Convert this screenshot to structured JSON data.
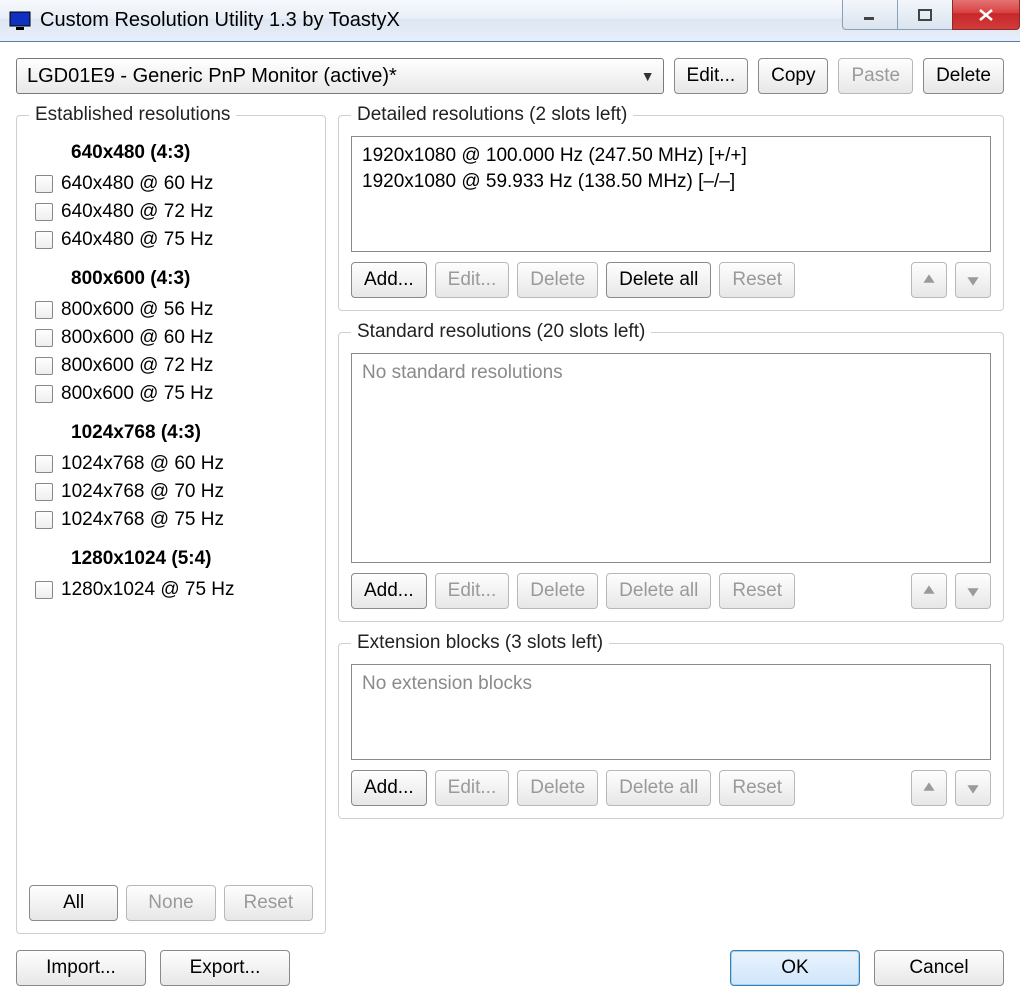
{
  "window": {
    "title": "Custom Resolution Utility 1.3 by ToastyX"
  },
  "top": {
    "monitor_selected": "LGD01E9 - Generic PnP Monitor (active)*",
    "edit": "Edit...",
    "copy": "Copy",
    "paste": "Paste",
    "delete": "Delete"
  },
  "established": {
    "legend": "Established resolutions",
    "groups": [
      {
        "head": "640x480 (4:3)",
        "items": [
          "640x480 @ 60 Hz",
          "640x480 @ 72 Hz",
          "640x480 @ 75 Hz"
        ]
      },
      {
        "head": "800x600 (4:3)",
        "items": [
          "800x600 @ 56 Hz",
          "800x600 @ 60 Hz",
          "800x600 @ 72 Hz",
          "800x600 @ 75 Hz"
        ]
      },
      {
        "head": "1024x768 (4:3)",
        "items": [
          "1024x768 @ 60 Hz",
          "1024x768 @ 70 Hz",
          "1024x768 @ 75 Hz"
        ]
      },
      {
        "head": "1280x1024 (5:4)",
        "items": [
          "1280x1024 @ 75 Hz"
        ]
      }
    ],
    "all": "All",
    "none": "None",
    "reset": "Reset"
  },
  "detailed": {
    "legend": "Detailed resolutions (2 slots left)",
    "items": [
      "1920x1080 @ 100.000 Hz (247.50 MHz) [+/+]",
      "1920x1080 @ 59.933 Hz (138.50 MHz) [–/–]"
    ],
    "add": "Add...",
    "edit": "Edit...",
    "delete": "Delete",
    "delete_all": "Delete all",
    "reset": "Reset"
  },
  "standard": {
    "legend": "Standard resolutions (20 slots left)",
    "placeholder": "No standard resolutions",
    "add": "Add...",
    "edit": "Edit...",
    "delete": "Delete",
    "delete_all": "Delete all",
    "reset": "Reset"
  },
  "extension": {
    "legend": "Extension blocks (3 slots left)",
    "placeholder": "No extension blocks",
    "add": "Add...",
    "edit": "Edit...",
    "delete": "Delete",
    "delete_all": "Delete all",
    "reset": "Reset"
  },
  "footer": {
    "import": "Import...",
    "export": "Export...",
    "ok": "OK",
    "cancel": "Cancel"
  }
}
